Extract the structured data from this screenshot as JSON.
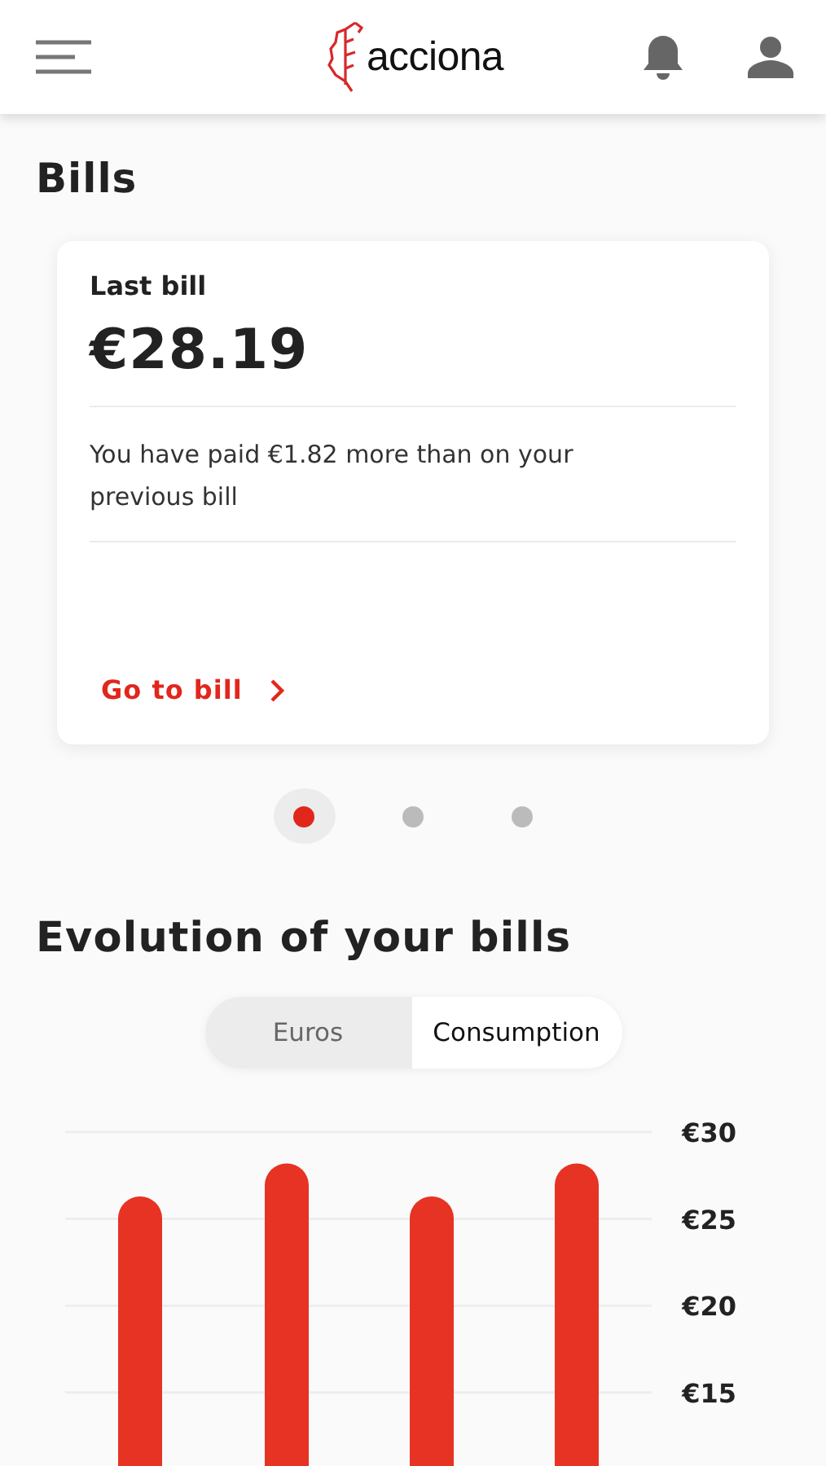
{
  "header": {
    "logo": "acciona"
  },
  "bills": {
    "title": "Bills",
    "card": {
      "label": "Last bill",
      "amount": "€28.19",
      "message": "You have paid €1.82 more than on your previous bill",
      "link": "Go to bill"
    },
    "pages": [
      {
        "selected": true
      },
      {
        "selected": false
      },
      {
        "selected": false
      }
    ]
  },
  "evolution": {
    "title": "Evolution of your bills",
    "tabs": [
      {
        "label": "Euros",
        "selected": false
      },
      {
        "label": "Consumption",
        "selected": true
      }
    ],
    "chart_data": {
      "type": "bar",
      "values": [
        26.3,
        28.2,
        26.3,
        28.2
      ],
      "grid": true,
      "ylim": [
        0,
        30
      ],
      "yticks": [
        {
          "value": 30,
          "label": "€30"
        },
        {
          "value": 25,
          "label": "€25"
        },
        {
          "value": 20,
          "label": "€20"
        },
        {
          "value": 15,
          "label": "€15"
        }
      ]
    }
  }
}
